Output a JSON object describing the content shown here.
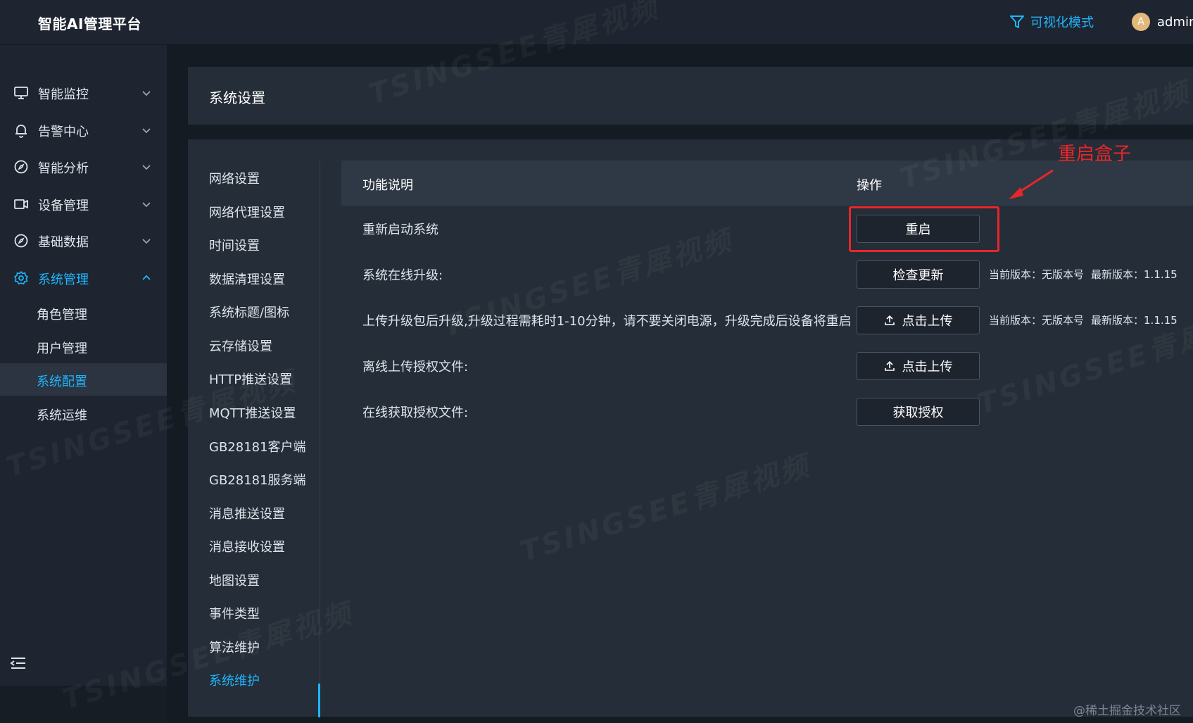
{
  "header": {
    "app_title": "智能AI管理平台",
    "visual_mode": "可视化模式",
    "user_name": "admin",
    "avatar_letter": "A"
  },
  "sidebar": {
    "items": [
      {
        "label": "智能监控",
        "icon": "monitor-icon"
      },
      {
        "label": "告警中心",
        "icon": "bell-icon"
      },
      {
        "label": "智能分析",
        "icon": "compass-icon"
      },
      {
        "label": "设备管理",
        "icon": "camera-icon"
      },
      {
        "label": "基础数据",
        "icon": "compass-icon"
      },
      {
        "label": "系统管理",
        "icon": "gear-icon",
        "expanded": true
      }
    ],
    "sub_items": [
      "角色管理",
      "用户管理",
      "系统配置",
      "系统运维"
    ],
    "selected_sub": "系统配置"
  },
  "page": {
    "title": "系统设置"
  },
  "settings_menu": [
    "网络设置",
    "网络代理设置",
    "时间设置",
    "数据清理设置",
    "系统标题/图标",
    "云存储设置",
    "HTTP推送设置",
    "MQTT推送设置",
    "GB28181客户端",
    "GB28181服务端",
    "消息推送设置",
    "消息接收设置",
    "地图设置",
    "事件类型",
    "算法维护",
    "系统维护"
  ],
  "settings_selected": "系统维护",
  "table": {
    "headers": {
      "description": "功能说明",
      "operation": "操作"
    },
    "rows": [
      {
        "description": "重新启动系统",
        "button": "重启",
        "icon": "",
        "version": ""
      },
      {
        "description": "系统在线升级:",
        "button": "检查更新",
        "icon": "",
        "current_version": "当前版本：无版本号",
        "latest_version": "最新版本：1.1.15"
      },
      {
        "description": "上传升级包后升级,升级过程需耗时1-10分钟，请不要关闭电源，升级完成后设备将重启",
        "button": "点击上传",
        "icon": "upload-icon",
        "current_version": "当前版本：无版本号",
        "latest_version": "最新版本：1.1.15"
      },
      {
        "description": "离线上传授权文件:",
        "button": "点击上传",
        "icon": "upload-icon"
      },
      {
        "description": "在线获取授权文件:",
        "button": "获取授权"
      }
    ]
  },
  "annotation": {
    "label": "重启盒子",
    "color": "#e8262a"
  },
  "watermark": "TSINGSEE青犀视频",
  "credit": "@稀土掘金技术社区",
  "colors": {
    "accent": "#1fb6ff",
    "background": "#151b23",
    "panel": "#252d38"
  }
}
